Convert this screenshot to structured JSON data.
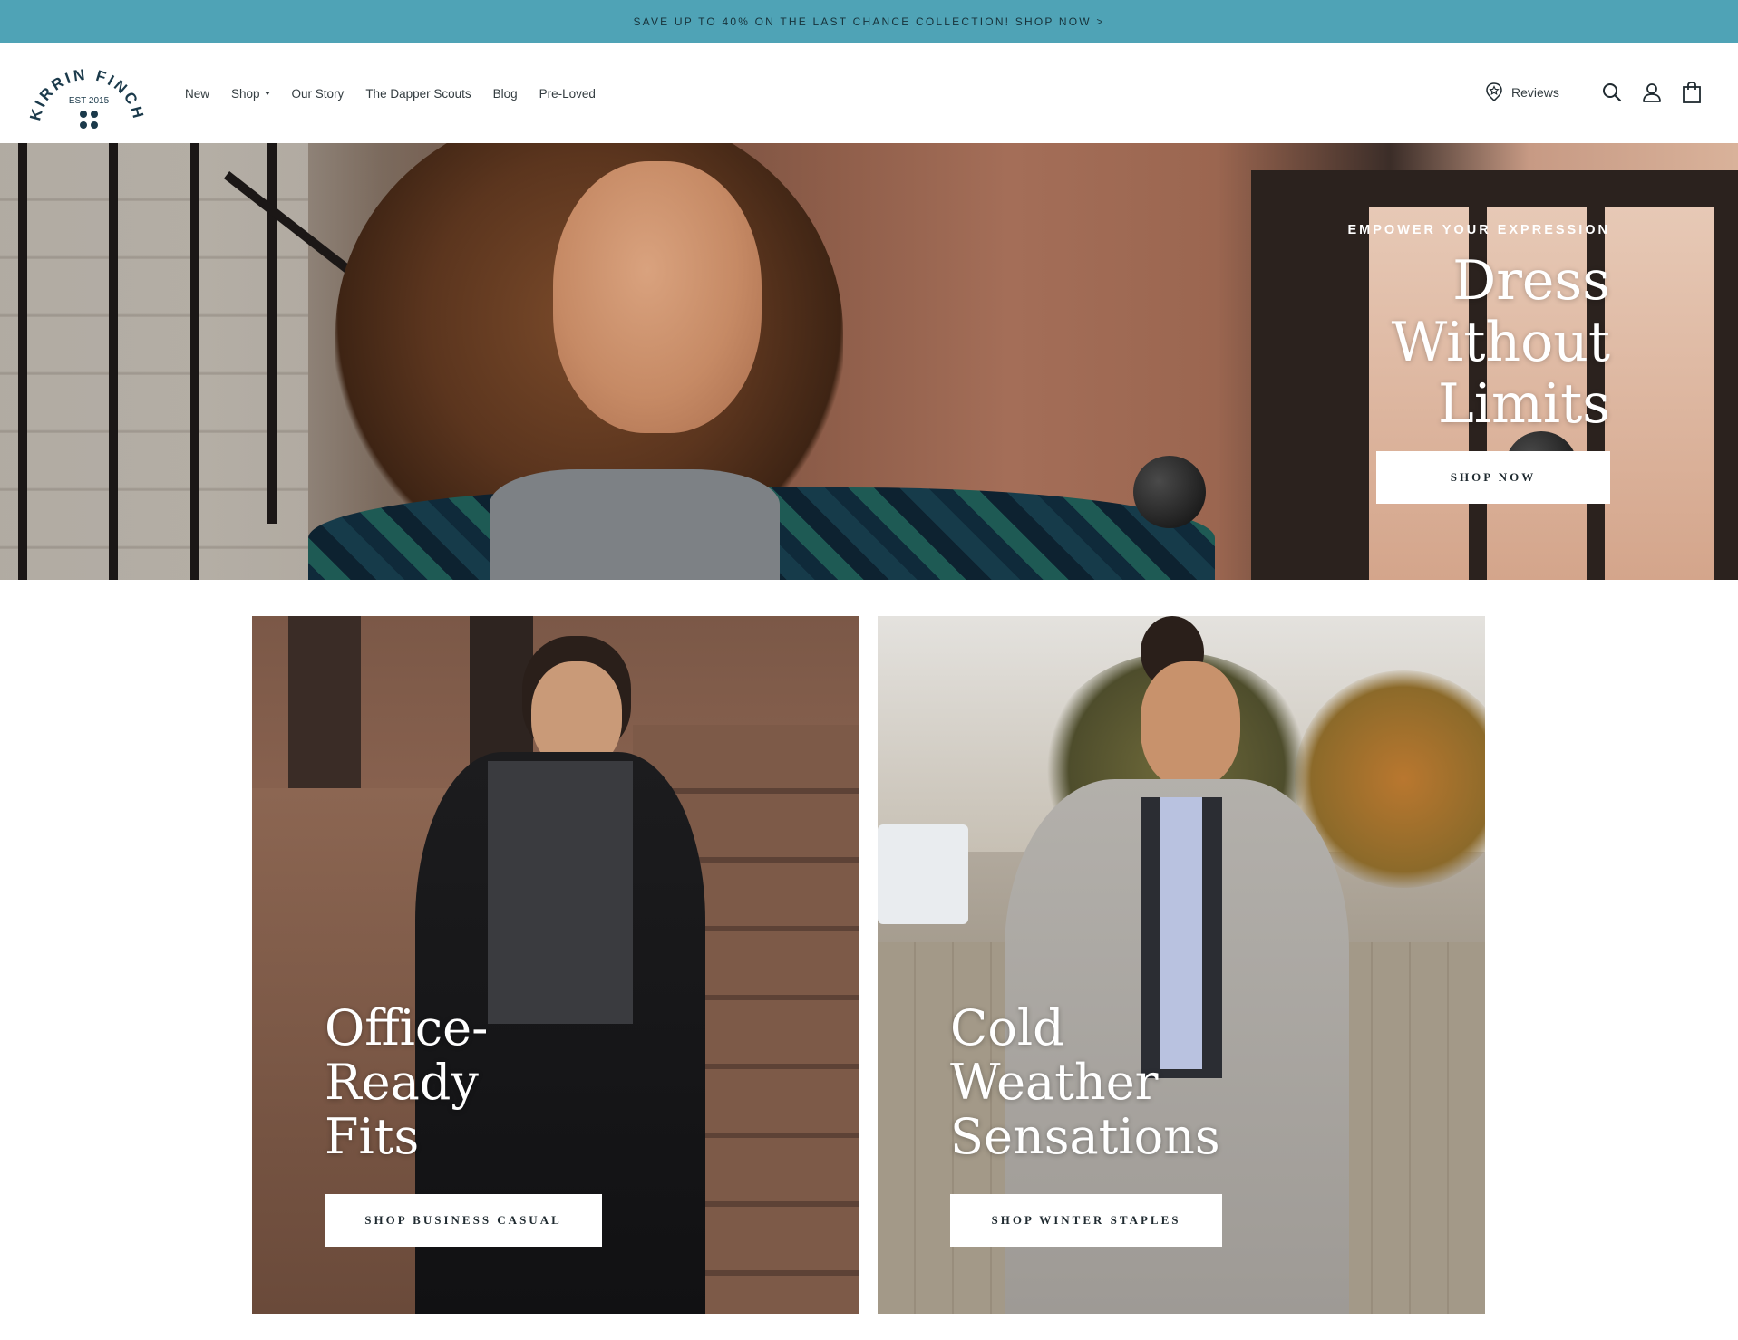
{
  "announcement": {
    "text": "SAVE UP TO 40% ON THE LAST CHANCE COLLECTION! SHOP NOW >"
  },
  "header": {
    "logo": {
      "brand": "KIRRIN FINCH",
      "established": "EST 2015"
    },
    "nav": [
      {
        "label": "New"
      },
      {
        "label": "Shop",
        "has_dropdown": true
      },
      {
        "label": "Our Story"
      },
      {
        "label": "The Dapper Scouts"
      },
      {
        "label": "Blog"
      },
      {
        "label": "Pre-Loved"
      }
    ],
    "reviews_label": "Reviews",
    "icons": [
      "reviews-badge-icon",
      "search-icon",
      "account-icon",
      "cart-icon"
    ]
  },
  "hero": {
    "eyebrow": "EMPOWER YOUR EXPRESSION",
    "title_lines": [
      "Dress",
      "Without",
      "Limits"
    ],
    "button_label": "SHOP NOW"
  },
  "tiles": [
    {
      "title_lines": [
        "Office-",
        "Ready",
        "Fits"
      ],
      "button_label": "SHOP BUSINESS CASUAL"
    },
    {
      "title_lines": [
        "Cold",
        "Weather",
        "Sensations"
      ],
      "button_label": "SHOP WINTER STAPLES"
    }
  ],
  "colors": {
    "announcement_bg": "#4fa3b6",
    "brand_navy": "#1b3a4b",
    "button_bg": "#ffffff"
  }
}
